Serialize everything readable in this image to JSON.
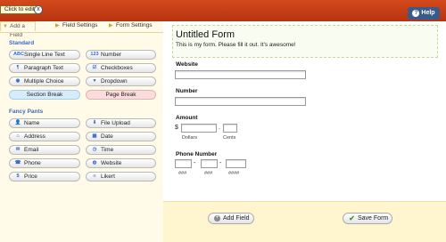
{
  "topbar": {
    "tooltip": "Click to edit.",
    "tooltip_close": "x",
    "help_label": "Help",
    "help_icon": "?"
  },
  "tabs": [
    {
      "label": "Add a Field"
    },
    {
      "label": "Field Settings"
    },
    {
      "label": "Form Settings"
    }
  ],
  "standard": {
    "title": "Standard",
    "fields": [
      {
        "icon": "ABC",
        "label": "Single Line Text"
      },
      {
        "icon": "123",
        "label": "Number"
      },
      {
        "icon": "¶",
        "label": "Paragraph Text"
      },
      {
        "icon": "☑",
        "label": "Checkboxes"
      },
      {
        "icon": "◉",
        "label": "Multiple Choice"
      },
      {
        "icon": "▾",
        "label": "Dropdown"
      }
    ],
    "section_break": "Section Break",
    "page_break": "Page Break"
  },
  "fancy": {
    "title": "Fancy Pants",
    "fields": [
      {
        "icon": "👤",
        "label": "Name"
      },
      {
        "icon": "⬇",
        "label": "File Upload"
      },
      {
        "icon": "⌂",
        "label": "Address"
      },
      {
        "icon": "▦",
        "label": "Date"
      },
      {
        "icon": "✉",
        "label": "Email"
      },
      {
        "icon": "◷",
        "label": "Time"
      },
      {
        "icon": "☎",
        "label": "Phone"
      },
      {
        "icon": "◍",
        "label": "Website"
      },
      {
        "icon": "$",
        "label": "Price"
      },
      {
        "icon": "≡",
        "label": "Likert"
      }
    ]
  },
  "form": {
    "title": "Untitled Form",
    "description": "This is my form. Please fill it out. It's awesome!",
    "fields": {
      "website": "Website",
      "number": "Number",
      "amount": "Amount",
      "phone": "Phone Number"
    },
    "amount": {
      "currency": "$",
      "dot": ".",
      "dollars": "Dollars",
      "cents": "Cents"
    },
    "phone": {
      "dash": "-",
      "area": "###",
      "prefix": "###",
      "line": "####"
    }
  },
  "footer": {
    "add_field": "Add Field",
    "save_form": "Save Form",
    "save_icon": "✔",
    "add_icon": "+"
  },
  "colors": {
    "topbar": "#c43d16",
    "accent_blue": "#3a6ac8",
    "sidebar_bg": "#fffbe8",
    "footer_bg": "#fff6cf",
    "section_break": "#d7ecfb",
    "page_break": "#fbdcdc",
    "save_check": "#3b9a2a"
  }
}
